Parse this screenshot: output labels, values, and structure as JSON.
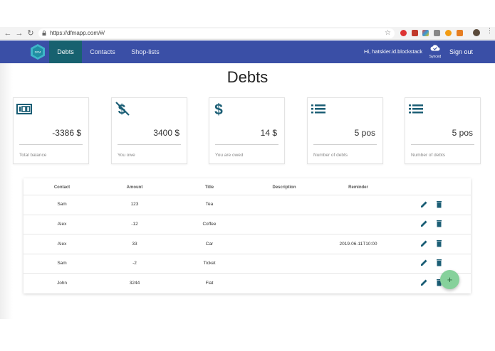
{
  "browser": {
    "url": "https://dfmapp.com/#/"
  },
  "nav": {
    "tabs": [
      {
        "label": "Debts"
      },
      {
        "label": "Contacts"
      },
      {
        "label": "Shop-lists"
      }
    ],
    "user_greeting": "Hi, hatskier.id.blockstack",
    "sync_label": "Synced",
    "signout_label": "Sign out"
  },
  "page": {
    "title": "Debts"
  },
  "cards": [
    {
      "icon": "balance-icon",
      "value": "-3386 $",
      "caption": "Total balance"
    },
    {
      "icon": "no-dollar-icon",
      "value": "3400 $",
      "caption": "You owe"
    },
    {
      "icon": "dollar-icon",
      "value": "14 $",
      "caption": "You are owed"
    },
    {
      "icon": "list-icon",
      "value": "5 pos",
      "caption": "Number of debts"
    },
    {
      "icon": "list-icon",
      "value": "5 pos",
      "caption": "Number of debts"
    }
  ],
  "table": {
    "headers": [
      "Contact",
      "Amount",
      "Title",
      "Description",
      "Reminder"
    ],
    "rows": [
      {
        "contact": "Sam",
        "amount": "123",
        "title": "Tea",
        "description": "",
        "reminder": ""
      },
      {
        "contact": "Alex",
        "amount": "-12",
        "title": "Coffee",
        "description": "",
        "reminder": ""
      },
      {
        "contact": "Alex",
        "amount": "33",
        "title": "Car",
        "description": "",
        "reminder": "2019-06-11T10:00"
      },
      {
        "contact": "Sam",
        "amount": "-2",
        "title": "Ticket",
        "description": "",
        "reminder": ""
      },
      {
        "contact": "John",
        "amount": "3244",
        "title": "Flat",
        "description": "",
        "reminder": ""
      }
    ]
  },
  "fab": {
    "label": "+"
  },
  "colors": {
    "navbar": "#3a4fa6",
    "active_tab": "#17616f",
    "icon": "#1b5e75",
    "fab": "#86d19b"
  }
}
